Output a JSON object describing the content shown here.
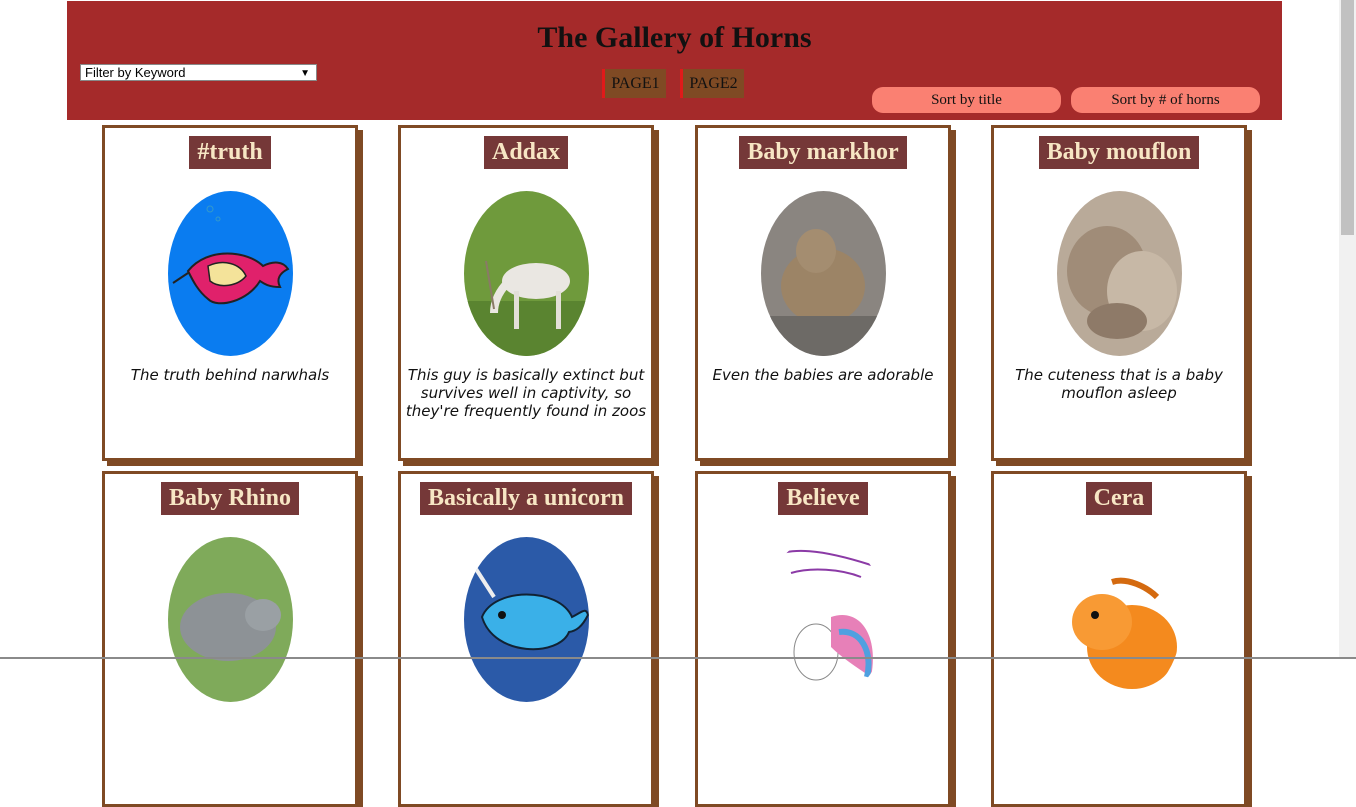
{
  "header": {
    "title": "The Gallery of Horns",
    "filter_label": "Filter by Keyword",
    "pages": [
      "PAGE1",
      "PAGE2"
    ],
    "sort_title": "Sort by title",
    "sort_horns": "Sort by # of horns"
  },
  "cards": [
    {
      "title": "#truth",
      "description": "The truth behind narwhals",
      "image": "narwhal-cartoon"
    },
    {
      "title": "Addax",
      "description": "This guy is basically extinct but survives well in captivity, so they're frequently found in zoos",
      "image": "addax-photo"
    },
    {
      "title": "Baby markhor",
      "description": "Even the babies are adorable",
      "image": "baby-markhor-photo"
    },
    {
      "title": "Baby mouflon",
      "description": "The cuteness that is a baby mouflon asleep",
      "image": "baby-mouflon-photo"
    },
    {
      "title": "Baby Rhino",
      "description": "",
      "image": "baby-rhino-photo"
    },
    {
      "title": "Basically a unicorn",
      "description": "",
      "image": "narwhal-cartoon-blue"
    },
    {
      "title": "Believe",
      "description": "",
      "image": "unicorn-illustration"
    },
    {
      "title": "Cera",
      "description": "",
      "image": "triceratops-cartoon"
    }
  ],
  "colors": {
    "banner": "#a52a2a",
    "card_border": "#7f4a24",
    "title_bg": "#753838",
    "title_text": "#f7e6c4",
    "sort_button": "#fa8072",
    "page_button": "#7f4a24"
  }
}
